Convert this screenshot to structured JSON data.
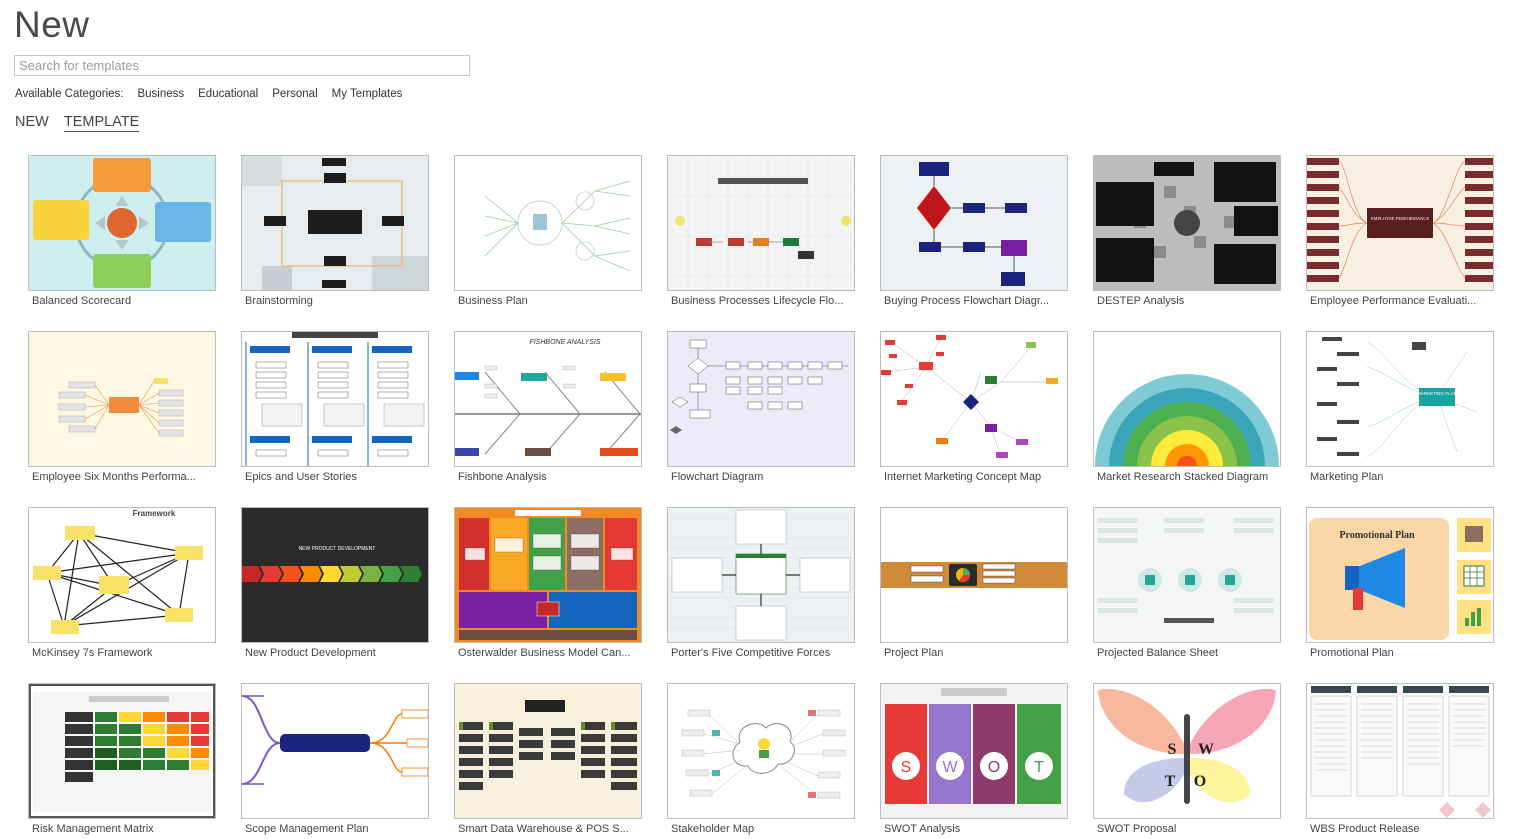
{
  "page": {
    "title": "New"
  },
  "search": {
    "placeholder": "Search for templates"
  },
  "categories": {
    "label": "Available Categories:",
    "items": [
      "Business",
      "Educational",
      "Personal",
      "My Templates"
    ]
  },
  "tabs": {
    "new": "NEW",
    "template": "TEMPLATE"
  },
  "templates": [
    "Balanced Scorecard",
    "Brainstorming",
    "Business Plan",
    "Business Processes Lifecycle Flo...",
    "Buying Process Flowchart Diagr...",
    "DESTEP Analysis",
    "Employee Performance Evaluati...",
    "Employee Six Months Performa...",
    "Epics and User Stories",
    "Fishbone Analysis",
    "Flowchart Diagram",
    "Internet Marketing Concept Map",
    "Market Research Stacked Diagram",
    "Marketing Plan",
    "McKinsey 7s Framework",
    "New Product Development",
    "Osterwalder Business Model Can...",
    "Porter's Five Competitive Forces",
    "Project Plan",
    "Projected Balance Sheet",
    "Promotional Plan",
    "Risk Management Matrix",
    "Scope Management Plan",
    "Smart Data Warehouse & POS S...",
    "Stakeholder Map",
    "SWOT Analysis",
    "SWOT Proposal",
    "WBS Product Release"
  ],
  "thumb_text": {
    "framework": "Framework",
    "fishbone": "FISHBONE ANALYSIS",
    "promo": "Promotional Plan",
    "npd": "NEW PRODUCT DEVELOPMENT",
    "emp": "EMPLOYEE PERFORMANCE",
    "mkt": "MARKETING PLAN",
    "swot_s": "S",
    "swot_w": "W",
    "swot_o": "O",
    "swot_t": "T"
  }
}
